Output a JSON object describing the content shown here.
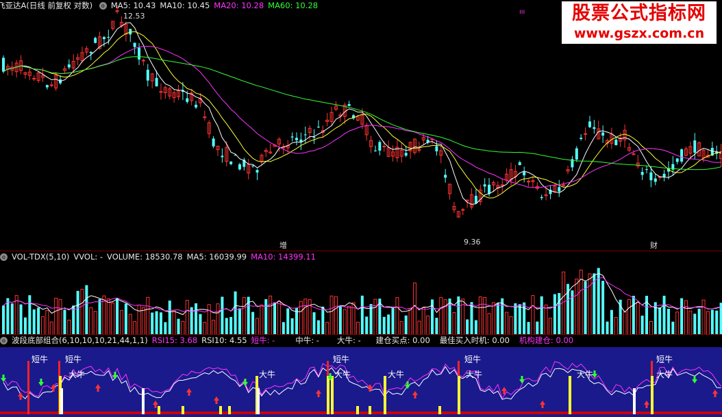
{
  "price": {
    "stock_title": "飞亚达A",
    "period_info": "(日线 前复权 对数)",
    "ma5": "MA5: 10.43",
    "ma10": "MA10: 10.45",
    "ma20": "MA20: 10.28",
    "ma60": "MA60: 10.28",
    "high_label": "12.53",
    "low_label": "9.36",
    "event1": "增",
    "event2": "财",
    "mark": "ııı"
  },
  "watermark": {
    "line1": "股票公式指标网",
    "line2": "www.gszx.com.cn"
  },
  "volume": {
    "name": "VOL-TDX(5,10)",
    "vvol": "VVOL: -",
    "volume": "VOLUME: 18530.78",
    "ma5": "MA5: 16039.99",
    "ma10": "MA10: 14399.11"
  },
  "indicator": {
    "name": "波段底部组合(6,10,10,10,21,44,1,1)",
    "rsi15": "RSI15: 3.68",
    "rsi10": "RSI10: 4.55",
    "short": "短牛: -",
    "mid": "中牛: -",
    "big": "大牛: -",
    "build": "建仓买点: 0.00",
    "best": "最佳买入时机: 0.00",
    "inst": "机构建仓: 0.00",
    "label_short": "短牛",
    "label_big": "大牛"
  },
  "colors": {
    "up": "#ff3333",
    "down": "#54ffff",
    "ma5": "#ffffff",
    "ma10": "#ffff33",
    "ma20": "#ff33ff",
    "ma60": "#33ff33",
    "indicator_bg": "#1a1a8c"
  },
  "icons": {
    "settings": "circle-icon"
  }
}
